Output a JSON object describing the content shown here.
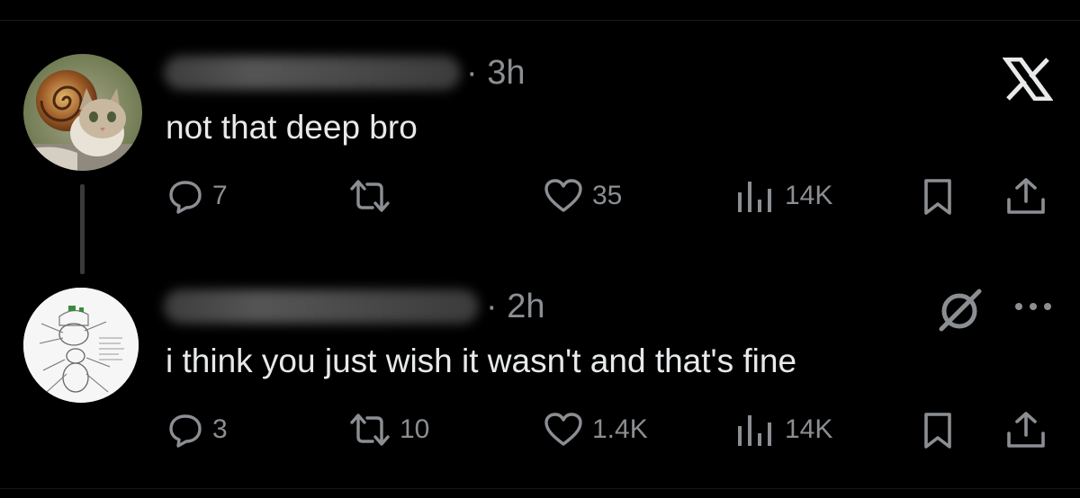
{
  "brand": {
    "icon": "x-logo-icon"
  },
  "tweets": [
    {
      "avatar": "snail-cat-avatar",
      "time": "· 3h",
      "text": "not that deep bro",
      "replies": "7",
      "reposts": "",
      "likes": "35",
      "views": "14K"
    },
    {
      "avatar": "sketch-avatar",
      "time": "· 2h",
      "text": "i think you just wish it wasn't and that's fine",
      "replies": "3",
      "reposts": "10",
      "likes": "1.4K",
      "views": "14K",
      "menu_icon": "more-icon",
      "badge_icon": "grok-icon"
    }
  ],
  "colors": {
    "background": "#000000",
    "text": "#e7e9ea",
    "muted": "#8b8e92"
  }
}
